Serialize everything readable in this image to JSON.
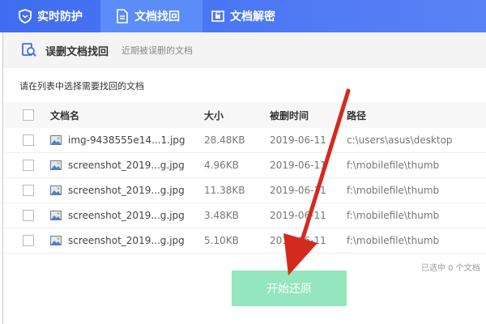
{
  "tabs": [
    {
      "label": "实时防护",
      "icon": "shield-icon",
      "active": false
    },
    {
      "label": "文档找回",
      "icon": "document-restore-icon",
      "active": true
    },
    {
      "label": "文档解密",
      "icon": "unlock-document-icon",
      "active": false
    }
  ],
  "section": {
    "title": "误删文档找回",
    "subtitle": "近期被误删的文档",
    "icon": "search-document-icon"
  },
  "instruction": "请在列表中选择需要找回的文档",
  "table": {
    "columns": [
      "文档名",
      "大小",
      "被删时间",
      "路径"
    ],
    "rows": [
      {
        "name": "img-9438555e14...1.jpg",
        "size": "28.48KB",
        "time": "2019-06-11",
        "path": "c:\\users\\asus\\desktop"
      },
      {
        "name": "screenshot_2019...g.jpg",
        "size": "4.96KB",
        "time": "2019-06-11",
        "path": "f:\\mobilefile\\thumb"
      },
      {
        "name": "screenshot_2019...g.jpg",
        "size": "11.38KB",
        "time": "2019-06-11",
        "path": "f:\\mobilefile\\thumb"
      },
      {
        "name": "screenshot_2019...g.jpg",
        "size": "3.48KB",
        "time": "2019-06-11",
        "path": "f:\\mobilefile\\thumb"
      },
      {
        "name": "screenshot_2019...g.jpg",
        "size": "5.10KB",
        "time": "2019-06-11",
        "path": "f:\\mobilefile\\thumb"
      }
    ]
  },
  "selected_count": "已选中 0 个文档",
  "start_button": "开始还原",
  "colors": {
    "header_blue": "#3f6df0",
    "active_tab": "#5b8cf8",
    "button_green": "#93e6bd",
    "arrow_red": "#d42a1e"
  }
}
